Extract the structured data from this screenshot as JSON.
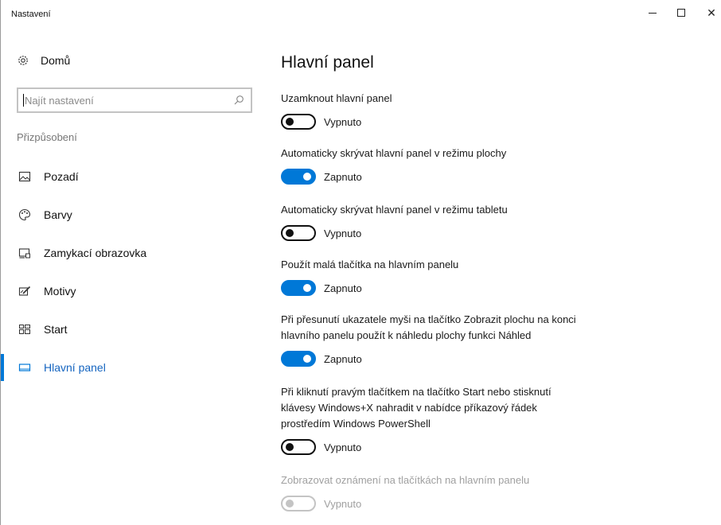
{
  "window": {
    "title": "Nastavení",
    "controls": {
      "minimize": "minimize-icon",
      "maximize": "maximize-icon",
      "close_glyph": "✕"
    }
  },
  "sidebar": {
    "home_label": "Domů",
    "search_placeholder": "Najít nastavení",
    "section_label": "Přizpůsobení",
    "items": [
      {
        "label": "Pozadí",
        "icon": "image-icon"
      },
      {
        "label": "Barvy",
        "icon": "palette-icon"
      },
      {
        "label": "Zamykací obrazovka",
        "icon": "lock-screen-icon"
      },
      {
        "label": "Motivy",
        "icon": "themes-icon"
      },
      {
        "label": "Start",
        "icon": "start-icon"
      },
      {
        "label": "Hlavní panel",
        "icon": "taskbar-icon",
        "active": true
      }
    ]
  },
  "main": {
    "title": "Hlavní panel",
    "settings": [
      {
        "description": "Uzamknout hlavní panel",
        "state": "Vypnuto",
        "on": false
      },
      {
        "description": "Automaticky skrývat hlavní panel v režimu plochy",
        "state": "Zapnuto",
        "on": true
      },
      {
        "description": "Automaticky skrývat hlavní panel v režimu tabletu",
        "state": "Vypnuto",
        "on": false
      },
      {
        "description": "Použít malá tlačítka na hlavním panelu",
        "state": "Zapnuto",
        "on": true
      },
      {
        "description_lines": [
          "Při přesunutí ukazatele myši na tlačítko Zobrazit plochu na konci",
          "hlavního panelu použít k náhledu plochy funkci Náhled"
        ],
        "state": "Zapnuto",
        "on": true
      },
      {
        "description_lines": [
          "Při kliknutí pravým tlačítkem na tlačítko Start nebo stisknutí",
          "klávesy Windows+X nahradit v nabídce příkazový řádek",
          "prostředím Windows PowerShell"
        ],
        "state": "Vypnuto",
        "on": false
      },
      {
        "description": "Zobrazovat oznámení na tlačítkách na hlavním panelu",
        "state": "Vypnuto",
        "on": false,
        "disabled": true
      }
    ]
  },
  "colors": {
    "accent": "#0078d7",
    "disabled": "#a0a0a0"
  }
}
